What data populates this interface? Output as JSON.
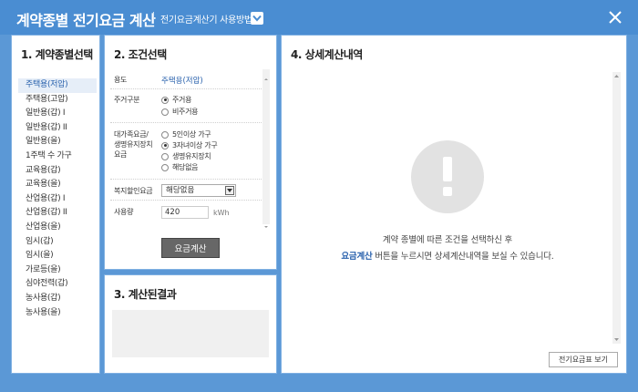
{
  "header": {
    "title": "계약종별 전기요금 계산",
    "howto_link": "전기요금계산기 사용방법",
    "chevron_icon": "chevron-down-icon",
    "close_icon": "close-icon",
    "bg_color": "#4a8dd2"
  },
  "panel1": {
    "title": "1. 계약종별선택",
    "items": [
      "주택용(저압)",
      "주택용(고압)",
      "일반용(갑) I",
      "일반용(갑) II",
      "일반용(을)",
      "1주택 수 가구",
      "교육용(갑)",
      "교육용(을)",
      "산업용(갑) I",
      "산업용(갑) II",
      "산업용(을)",
      "임시(갑)",
      "임시(을)",
      "가로등(을)",
      "심야전력(갑)",
      "농사용(갑)",
      "농사용(을)"
    ],
    "selected_index": 0
  },
  "panel2": {
    "title": "2. 조건선택",
    "usage_label": "용도",
    "usage_value": "주택용(저압)",
    "residence_label": "주거구분",
    "residence_options": [
      "주거용",
      "비주거용"
    ],
    "residence_selected": 0,
    "discount_label_1": "대가족요금/",
    "discount_label_2": "생명유지장치",
    "discount_label_3": "요금",
    "discount_options": [
      "5인이상 가구",
      "3자녀이상 가구",
      "생명유지장치",
      "해당없음"
    ],
    "discount_selected": 1,
    "welfare_label": "복지할인요금",
    "welfare_value": "해당없음",
    "usage_amount_label": "사용량",
    "usage_amount_value": "420",
    "usage_amount_unit": "kWh",
    "calc_button": "요금계산"
  },
  "panel3": {
    "title": "3. 계산된결과"
  },
  "panel4": {
    "title": "4. 상세계산내역",
    "alert_icon": "exclamation-icon",
    "message_line1": "계약 종별에 따른 조건을 선택하신 후",
    "message_line2_highlight": "요금계산",
    "message_line2_rest": " 버튼을 누르시면 상세계산내역을 보실 수 있습니다.",
    "view_button": "전기요금표 보기"
  }
}
